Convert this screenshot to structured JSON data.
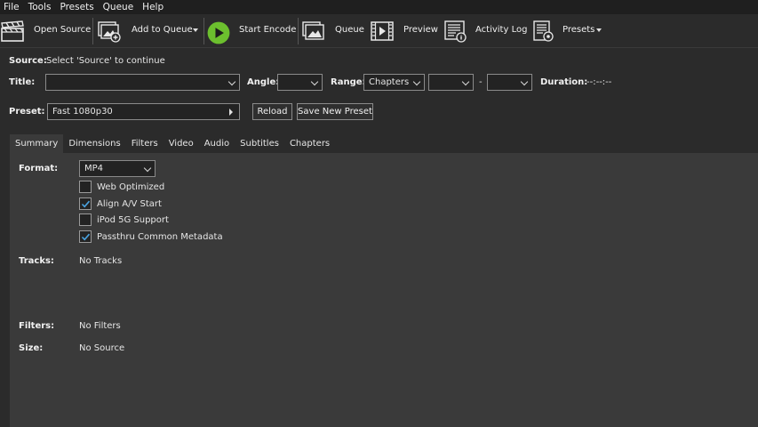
{
  "menu": [
    "File",
    "Tools",
    "Presets",
    "Queue",
    "Help"
  ],
  "toolbar": {
    "open_source": "Open Source",
    "add_to_queue": "Add to Queue",
    "start_encode": "Start Encode",
    "queue": "Queue",
    "preview": "Preview",
    "activity_log": "Activity Log",
    "presets": "Presets"
  },
  "source": {
    "label": "Source:",
    "value": "Select 'Source' to continue"
  },
  "title_row": {
    "title_label": "Title:",
    "title_value": "",
    "angle_label": "Angle:",
    "angle_value": "",
    "range_label": "Range:",
    "range_value": "Chapters",
    "range_start": "",
    "range_separator": "-",
    "range_end": "",
    "duration_label": "Duration:",
    "duration_value": "--:--:--"
  },
  "preset_row": {
    "label": "Preset:",
    "value": "Fast 1080p30",
    "reload": "Reload",
    "save_new": "Save New Preset"
  },
  "tabs": [
    "Summary",
    "Dimensions",
    "Filters",
    "Video",
    "Audio",
    "Subtitles",
    "Chapters"
  ],
  "active_tab": "Summary",
  "summary": {
    "format_label": "Format:",
    "format_value": "MP4",
    "options": [
      {
        "label": "Web Optimized",
        "checked": false
      },
      {
        "label": "Align A/V Start",
        "checked": true
      },
      {
        "label": "iPod 5G Support",
        "checked": false
      },
      {
        "label": "Passthru Common Metadata",
        "checked": true
      }
    ],
    "tracks_label": "Tracks:",
    "tracks_value": "No Tracks",
    "filters_label": "Filters:",
    "filters_value": "No Filters",
    "size_label": "Size:",
    "size_value": "No Source"
  },
  "colors": {
    "background": "#2b2b2b",
    "panel": "#3a3a3a",
    "accent_check": "#4aa3e0",
    "play_green": "#6cbf2e"
  }
}
